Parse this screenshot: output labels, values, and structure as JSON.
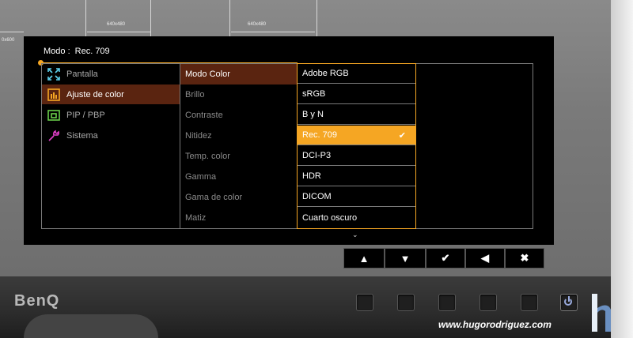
{
  "screen": {
    "res_labels": [
      "640x480",
      "640x480",
      "0x600"
    ]
  },
  "osd": {
    "mode_label": "Modo :",
    "mode_value": "Rec. 709",
    "main_menu": [
      {
        "label": "Pantalla",
        "icon": "display-arrows-icon",
        "selected": false
      },
      {
        "label": "Ajuste de color",
        "icon": "color-adjust-icon",
        "selected": true
      },
      {
        "label": "PIP / PBP",
        "icon": "pip-icon",
        "selected": false
      },
      {
        "label": "Sistema",
        "icon": "wrench-icon",
        "selected": false
      }
    ],
    "sub_menu": [
      "Modo Color",
      "Brillo",
      "Contraste",
      "Nitidez",
      "Temp. color",
      "Gamma",
      "Gama de color",
      "Matiz"
    ],
    "options": [
      "Adobe RGB",
      "sRGB",
      "B y N",
      "Rec. 709",
      "DCI-P3",
      "HDR",
      "DICOM",
      "Cuarto oscuro"
    ],
    "selected_option_index": 3,
    "check_glyph": "✔",
    "more_glyph": "⌄",
    "accent": "#f5a623"
  },
  "keys": [
    "▲",
    "▼",
    "✔",
    "◀",
    "✖"
  ],
  "brand": "BenQ",
  "watermark": "www.hugorodriguez.com"
}
